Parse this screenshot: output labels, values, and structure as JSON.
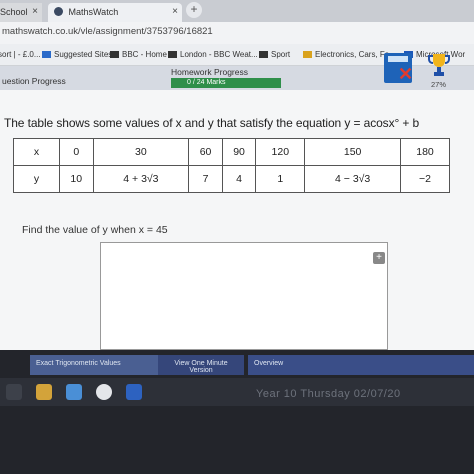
{
  "browser": {
    "tabs": [
      {
        "label": "School",
        "close": "×"
      },
      {
        "label": "MathsWatch",
        "close": "×"
      }
    ],
    "new_tab": "+",
    "url": "mathswatch.co.uk/vle/assignment/3753796/16821",
    "bookmarks": [
      {
        "label": "sort | - £.0..."
      },
      {
        "label": "Suggested Sites"
      },
      {
        "label": "BBC - Home"
      },
      {
        "label": "London - BBC Weat..."
      },
      {
        "label": "Sport"
      },
      {
        "label": "Electronics, Cars, Fa..."
      },
      {
        "label": "Microsoft Wor"
      }
    ]
  },
  "progress": {
    "question_label": "uestion Progress",
    "homework_label": "Homework Progress",
    "homework_value": "0 / 24 Marks",
    "percent": "27%"
  },
  "question": {
    "text": "The table shows some values of x and y that satisfy the equation y = acosx° + b"
  },
  "table": {
    "x_header": "x",
    "y_header": "y",
    "x_values": [
      "0",
      "30",
      "60",
      "90",
      "120",
      "150",
      "180"
    ],
    "y_values": [
      "10",
      "4 + 3√3",
      "7",
      "4",
      "1",
      "4 − 3√3",
      "−2"
    ]
  },
  "prompt": {
    "text": "Find the value of y when x = 45"
  },
  "answer": {
    "plus": "+"
  },
  "bottom_tabs": [
    {
      "label": "Exact Trigonometric Values"
    },
    {
      "label": "View One Minute Version"
    },
    {
      "label": "Overview"
    }
  ],
  "bottom_text": "Year 10 Thursday 02/07/20",
  "colors": {
    "progress_green": "#2f8f4a",
    "calc_blue": "#1e63b8",
    "tab_blue": "#3a4e88"
  }
}
